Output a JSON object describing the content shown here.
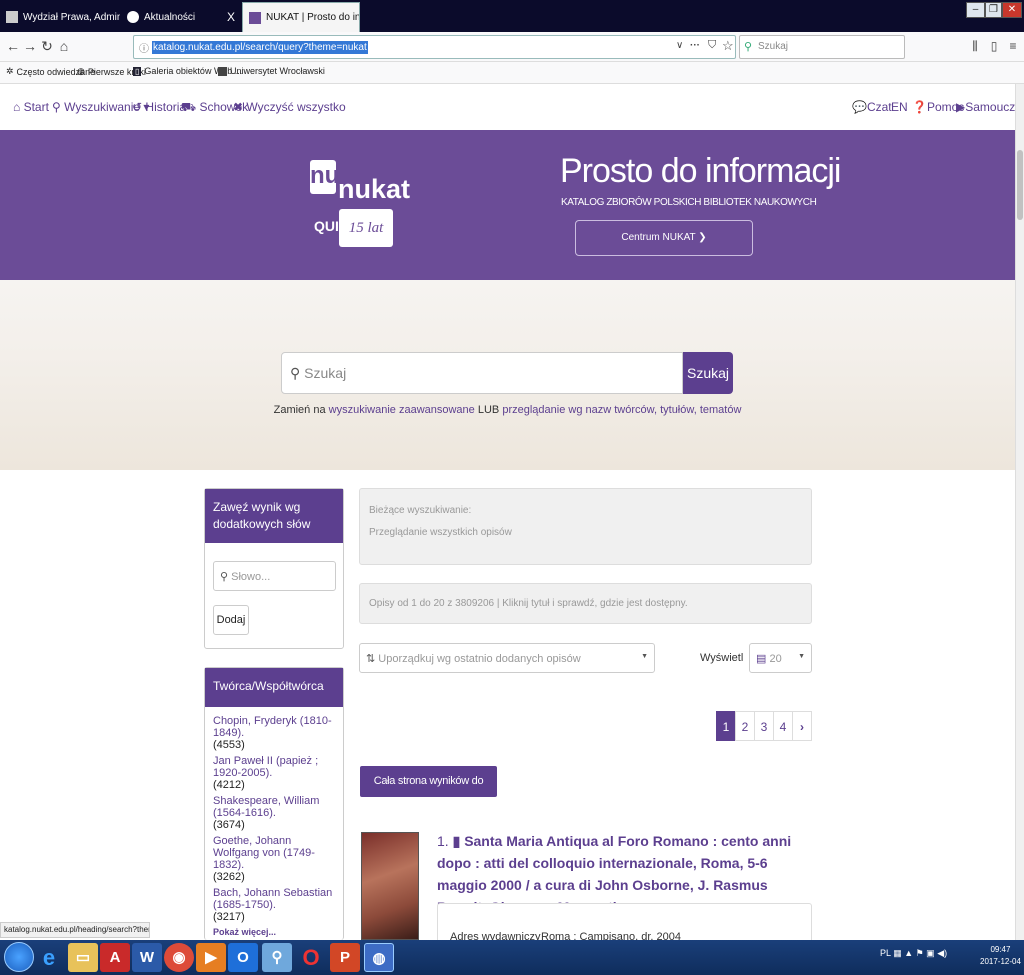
{
  "browser": {
    "tabs": [
      {
        "label": "Wydział Prawa, Administracji i ",
        "close": "X"
      },
      {
        "label": "Aktualności",
        "close": "X"
      },
      {
        "label": "NUKAT | Prosto do informacji -",
        "close": "X"
      }
    ],
    "window_controls": [
      "–",
      "❐",
      "✕"
    ],
    "url": "katalog.nukat.edu.pl/search/query?theme=nukat",
    "search_placeholder": "Szukaj",
    "more_label": "···",
    "bookmarks": [
      "Często odwiedzane",
      "Pierwsze kroki",
      "Galeria obiektów Web ...",
      "Uniwersytet Wrocławski"
    ]
  },
  "site_nav": {
    "left": [
      "Start",
      "Wyszukiwanie ▾",
      "Historia",
      "Schowek",
      "Wyczyść wszystko"
    ],
    "right": [
      "Czat",
      "EN",
      "Pomoc",
      "Samouczek"
    ]
  },
  "banner": {
    "logo_mark": "nu",
    "logo_text": "nukat",
    "quiz": "QUIZ",
    "anniversary": "15 lat",
    "slogan": "Prosto do informacji",
    "subtitle": "KATALOG ZBIORÓW POLSKICH BIBLIOTEK NAUKOWYCH",
    "centrum_button": "Centrum NUKAT ❯"
  },
  "hero": {
    "search_placeholder": "Szukaj",
    "search_button": "Szukaj",
    "hint_prefix": "Zamień na",
    "hint_link1": "wyszukiwanie zaawansowane",
    "hint_mid": "LUB",
    "hint_link2": "przeglądanie wg nazw twórców, tytułów, tematów"
  },
  "sidebar": {
    "refine_title": "Zawęź wynik wg dodatkowych słów",
    "word_placeholder": "Słowo...",
    "add_button": "Dodaj",
    "creators_title": "Twórca/Współtwórca",
    "creators": [
      {
        "name": "Chopin, Fryderyk (1810-1849).",
        "count": "(4553)"
      },
      {
        "name": "Jan Paweł II (papież ; 1920-2005).",
        "count": "(4212)"
      },
      {
        "name": "Shakespeare, William (1564-1616).",
        "count": "(3674)"
      },
      {
        "name": "Goethe, Johann Wolfgang von (1749-1832).",
        "count": "(3262)"
      },
      {
        "name": "Bach, Johann Sebastian (1685-1750).",
        "count": "(3217)"
      }
    ],
    "more": "Pokaż więcej..."
  },
  "main": {
    "current_label": "Bieżące wyszukiwanie:",
    "current_value": "Przeglądanie wszystkich opisów",
    "results_info": "Opisy od 1 do 20 z 3809206 | Kliknij tytuł i sprawdź, gdzie jest dostępny.",
    "sort_label": "Uporządkuj wg ostatnio dodanych opisów",
    "display_label": "Wyświetl",
    "per_page": "20",
    "pages": [
      "1",
      "2",
      "3",
      "4",
      "›"
    ],
    "all_to_clipboard": "Cała strona wyników do schowka",
    "result": {
      "number": "1.",
      "title": "Santa Maria Antiqua al Foro Romano : cento anni dopo : atti del colloquio internazionale, Roma, 5-6 maggio 2000 / a cura di John Osborne, J. Rasmus Brandt, Giuseppe Morganti.",
      "publisher_label": "Adres wydawniczy",
      "publisher_value": "Roma : Campisano, dr. 2004"
    }
  },
  "status_bar": "katalog.nukat.edu.pl/heading/search?theme=nukat",
  "taskbar": {
    "tray": "PL",
    "time": "09:47",
    "date": "2017-12-04"
  },
  "colors": {
    "accent": "#5c3f8f",
    "banner": "#6b4c97"
  }
}
